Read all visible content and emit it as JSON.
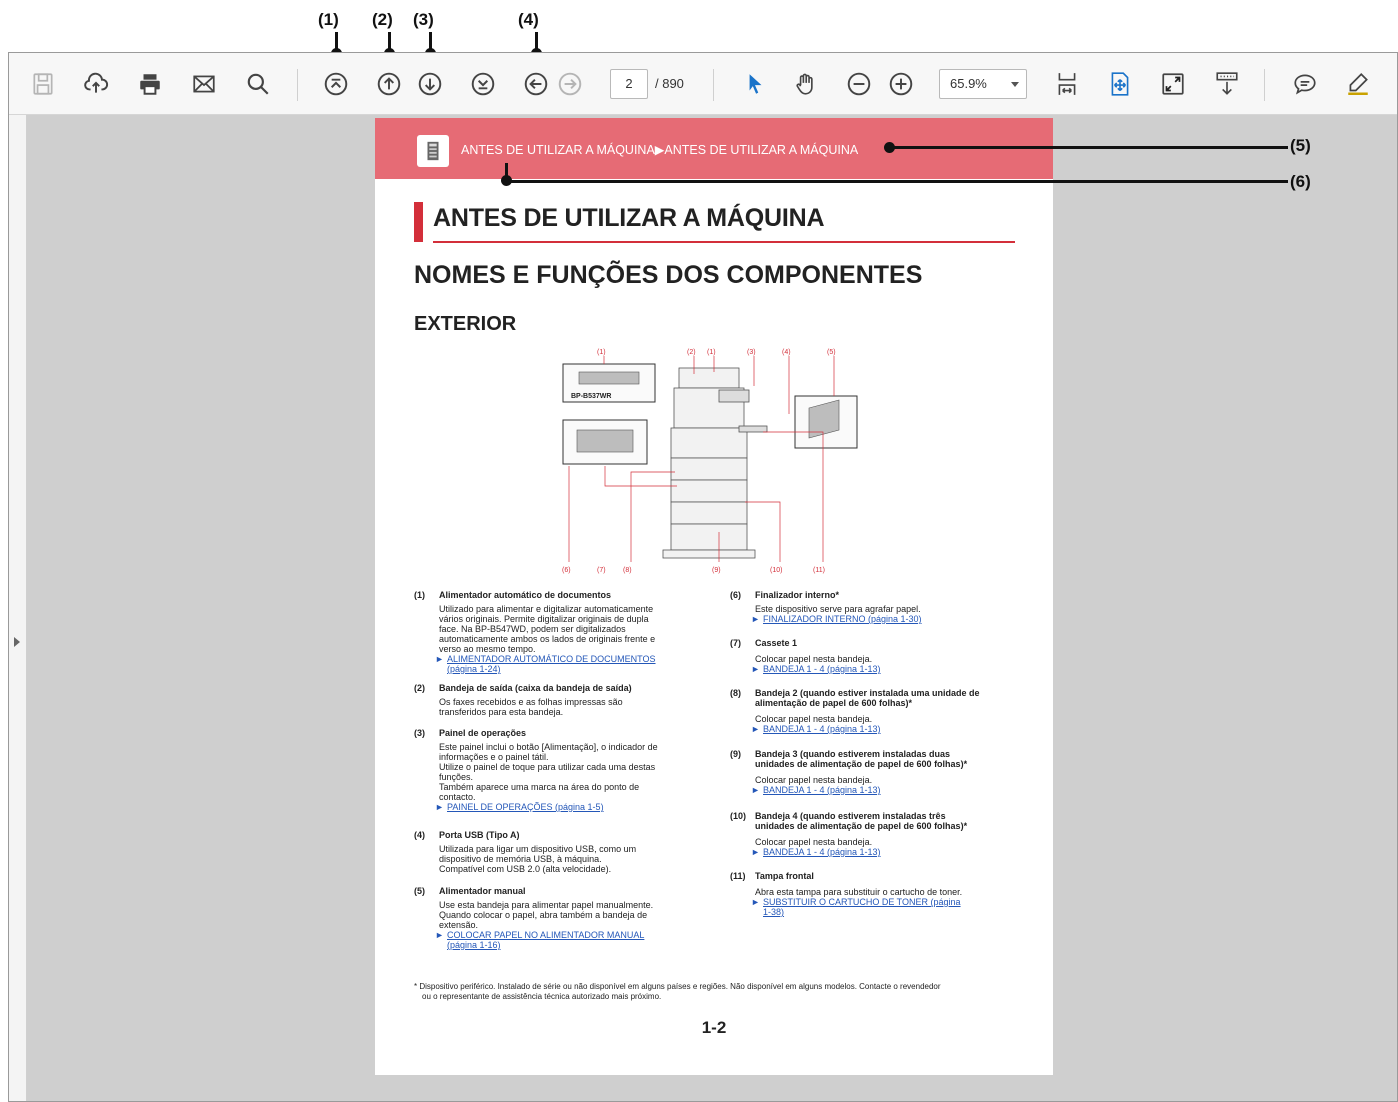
{
  "callouts": {
    "c1": "(1)",
    "c2": "(2)",
    "c3": "(3)",
    "c4": "(4)",
    "c5": "(5)",
    "c6": "(6)"
  },
  "toolbar": {
    "icons": [
      "save-icon",
      "cloud-upload-icon",
      "print-icon",
      "email-icon",
      "search-icon",
      "first-page-icon",
      "previous-page-icon",
      "next-page-icon",
      "last-page-icon",
      "previous-view-icon",
      "next-view-icon",
      "select-arrow-icon",
      "hand-tool-icon",
      "zoom-out-icon",
      "zoom-in-icon",
      "fit-page-icon",
      "fit-width-icon",
      "full-screen-icon",
      "scrolling-mode-icon",
      "comment-icon",
      "highlight-icon"
    ],
    "page_current": "2",
    "page_total": "/ 890",
    "zoom": "65.9%"
  },
  "document": {
    "banner": "ANTES DE UTILIZAR A MÁQUINA▶ANTES DE UTILIZAR A MÁQUINA",
    "h1": "ANTES DE UTILIZAR A MÁQUINA",
    "h2": "NOMES E FUNÇÕES DOS COMPONENTES",
    "h3": "EXTERIOR",
    "diagram": {
      "model_label": "BP-B537WR",
      "numbers": [
        "(1)",
        "(2)",
        "(1)",
        "(3)",
        "(4)",
        "(5)",
        "(6)",
        "(7)",
        "(8)",
        "(9)",
        "(10)",
        "(11)"
      ]
    },
    "left_items": [
      {
        "num": "(1)",
        "title": "Alimentador automático de documentos",
        "body": [
          "Utilizado para alimentar e digitalizar automaticamente",
          "vários originais. Permite digitalizar originais de dupla",
          "face. Na BP-B547WD, podem ser digitalizados",
          "automaticamente ambos os lados de originais frente e",
          "verso ao mesmo tempo."
        ],
        "link": [
          "ALIMENTADOR AUTOMÁTICO DE DOCUMENTOS",
          "(página 1-24)"
        ]
      },
      {
        "num": "(2)",
        "title": "Bandeja de saída (caixa da bandeja de saída)",
        "body": [
          "Os faxes recebidos e as folhas impressas são",
          "transferidos para esta bandeja."
        ],
        "link": []
      },
      {
        "num": "(3)",
        "title": "Painel de operações",
        "body": [
          "Este painel inclui o botão [Alimentação], o indicador de",
          "informações e o painel tátil.",
          "Utilize o painel de toque para utilizar cada uma destas",
          "funções.",
          "Também aparece uma marca na área do ponto de",
          "contacto."
        ],
        "link": [
          "PAINEL DE OPERAÇÕES (página 1-5)"
        ]
      },
      {
        "num": "(4)",
        "title": "Porta USB (Tipo A)",
        "body": [
          "Utilizada para ligar um dispositivo USB, como um",
          "dispositivo de memória USB, à máquina.",
          "Compatível com USB 2.0 (alta velocidade)."
        ],
        "link": []
      },
      {
        "num": "(5)",
        "title": "Alimentador manual",
        "body": [
          "Use esta bandeja para alimentar papel manualmente.",
          "Quando colocar o papel, abra também a bandeja de",
          "extensão."
        ],
        "link": [
          "COLOCAR PAPEL NO ALIMENTADOR MANUAL",
          "(página 1-16)"
        ]
      }
    ],
    "right_items": [
      {
        "num": "(6)",
        "title": "Finalizador interno*",
        "body": [
          "Este dispositivo serve para agrafar papel."
        ],
        "link": [
          "FINALIZADOR INTERNO (página 1-30)"
        ]
      },
      {
        "num": "(7)",
        "title": "Cassete 1",
        "body": [
          "Colocar papel nesta bandeja."
        ],
        "link": [
          "BANDEJA 1 - 4 (página 1-13)"
        ]
      },
      {
        "num": "(8)",
        "title": "Bandeja 2 (quando estiver instalada uma unidade de",
        "title2": "alimentação de papel de 600 folhas)*",
        "body": [
          "Colocar papel nesta bandeja."
        ],
        "link": [
          "BANDEJA 1 - 4 (página 1-13)"
        ]
      },
      {
        "num": "(9)",
        "title": "Bandeja 3 (quando estiverem instaladas duas",
        "title2": "unidades de alimentação de papel de 600 folhas)*",
        "body": [
          "Colocar papel nesta bandeja."
        ],
        "link": [
          "BANDEJA 1 - 4 (página 1-13)"
        ]
      },
      {
        "num": "(10)",
        "title": "Bandeja 4 (quando estiverem instaladas três",
        "title2": "unidades de alimentação de papel de 600 folhas)*",
        "body": [
          "Colocar papel nesta bandeja."
        ],
        "link": [
          "BANDEJA 1 - 4 (página 1-13)"
        ]
      },
      {
        "num": "(11)",
        "title": "Tampa frontal",
        "body": [
          "Abra esta tampa para substituir o cartucho de toner."
        ],
        "link": [
          "SUBSTITUIR O CARTUCHO DE TONER (página",
          "1-38)"
        ]
      }
    ],
    "footnote": [
      "* Dispositivo periférico. Instalado de série ou não disponível em alguns países e regiões. Não disponível em alguns modelos. Contacte o revendedor",
      "ou o representante de assistência técnica autorizado mais próximo."
    ],
    "page_number": "1-2"
  }
}
